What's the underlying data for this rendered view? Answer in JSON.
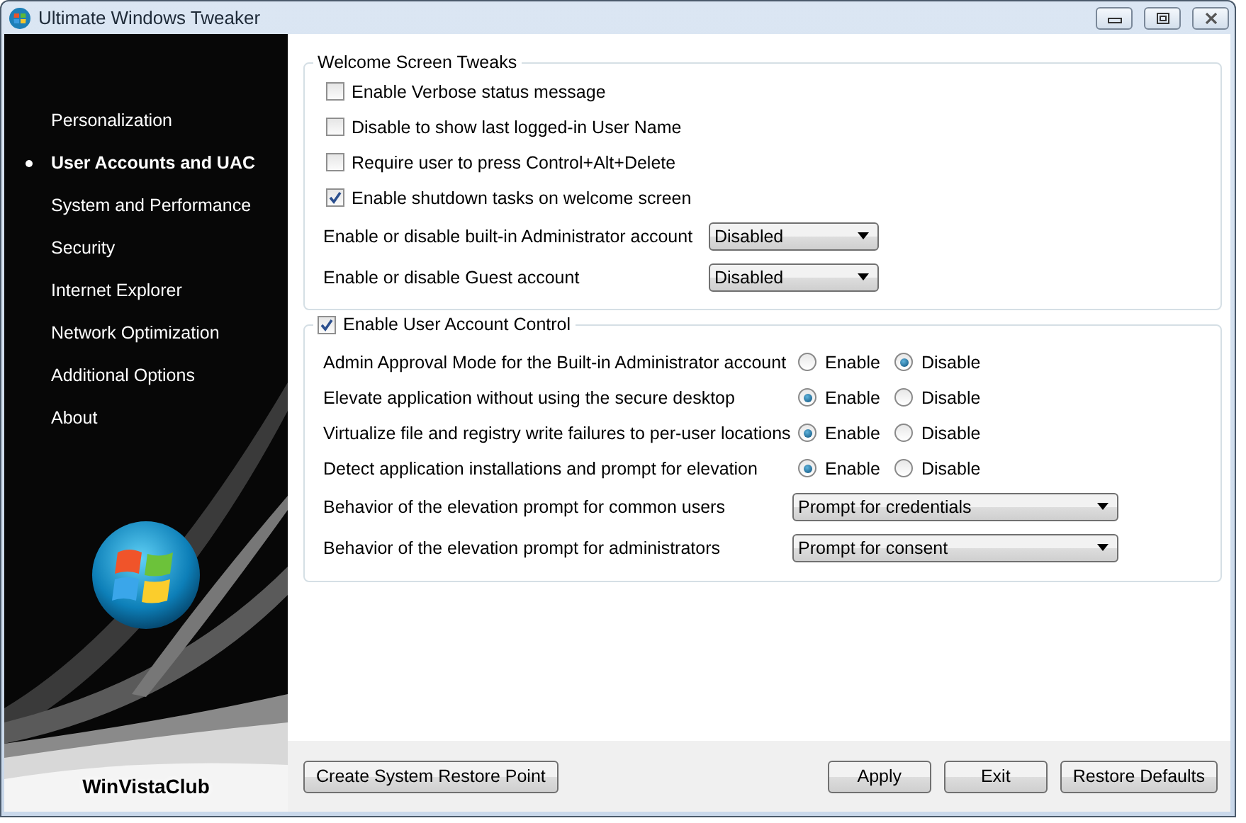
{
  "window": {
    "title": "Ultimate Windows Tweaker"
  },
  "sidebar": {
    "items": [
      {
        "label": "Personalization",
        "selected": false
      },
      {
        "label": "User Accounts and UAC",
        "selected": true
      },
      {
        "label": "System and Performance",
        "selected": false
      },
      {
        "label": "Security",
        "selected": false
      },
      {
        "label": "Internet Explorer",
        "selected": false
      },
      {
        "label": "Network Optimization",
        "selected": false
      },
      {
        "label": "Additional Options",
        "selected": false
      },
      {
        "label": "About",
        "selected": false
      }
    ],
    "footer": "WinVistaClub"
  },
  "welcome_screen_tweaks": {
    "title": "Welcome Screen Tweaks",
    "checkboxes": [
      {
        "label": "Enable Verbose status message",
        "checked": false
      },
      {
        "label": "Disable to show last logged-in User Name",
        "checked": false
      },
      {
        "label": "Require user to press Control+Alt+Delete",
        "checked": false
      },
      {
        "label": "Enable shutdown tasks on welcome screen",
        "checked": true
      }
    ],
    "dropdowns": [
      {
        "label": "Enable or disable built-in Administrator account",
        "value": "Disabled"
      },
      {
        "label": "Enable or disable Guest account",
        "value": "Disabled"
      }
    ]
  },
  "user_account_control": {
    "title": "Enable User Account Control",
    "checked": true,
    "radio_rows": [
      {
        "label": "Admin Approval Mode for the Built-in Administrator account",
        "options": [
          {
            "label": "Enable",
            "selected": false
          },
          {
            "label": "Disable",
            "selected": true
          }
        ]
      },
      {
        "label": "Elevate application without using the secure desktop",
        "options": [
          {
            "label": "Enable",
            "selected": true
          },
          {
            "label": "Disable",
            "selected": false
          }
        ]
      },
      {
        "label": "Virtualize file and registry write failures to per-user locations",
        "options": [
          {
            "label": "Enable",
            "selected": true
          },
          {
            "label": "Disable",
            "selected": false
          }
        ]
      },
      {
        "label": "Detect application installations and prompt for elevation",
        "options": [
          {
            "label": "Enable",
            "selected": true
          },
          {
            "label": "Disable",
            "selected": false
          }
        ]
      }
    ],
    "dropdowns": [
      {
        "label": "Behavior of the elevation prompt for common users",
        "value": "Prompt for credentials"
      },
      {
        "label": "Behavior of the elevation prompt for administrators",
        "value": "Prompt for consent"
      }
    ]
  },
  "footer_buttons_left": [
    "Create System Restore Point"
  ],
  "footer_buttons_right": [
    "Apply",
    "Exit",
    "Restore Defaults"
  ]
}
